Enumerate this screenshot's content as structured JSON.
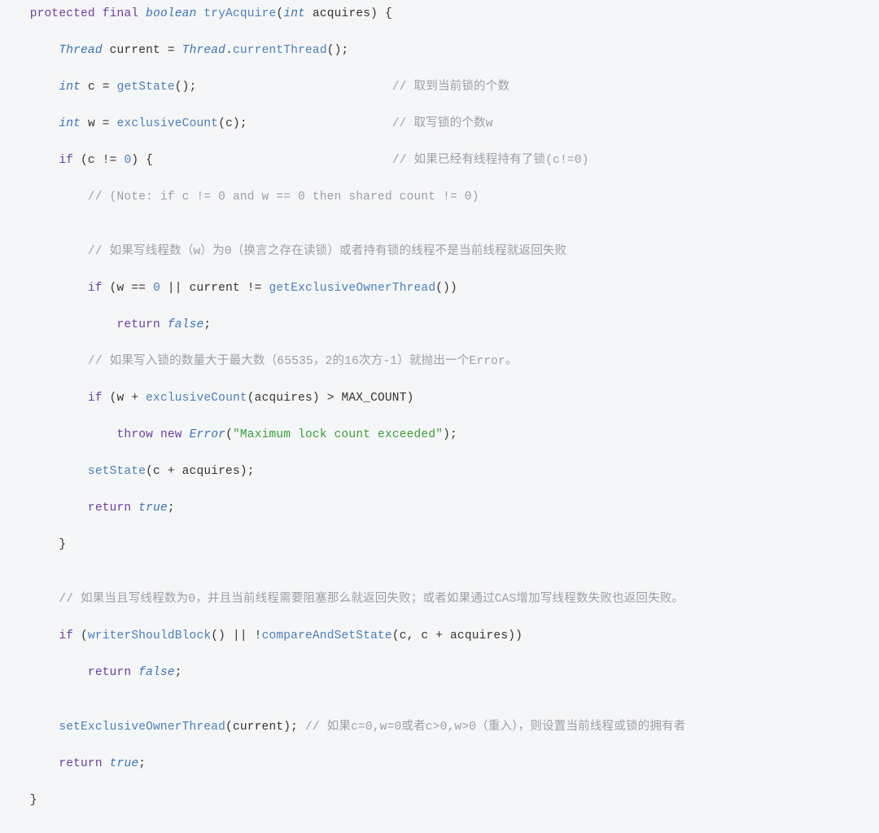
{
  "code": {
    "l1": {
      "kw_protected": "protected",
      "kw_final": "final",
      "type_boolean": "boolean",
      "fn": "tryAcquire",
      "type_int": "int",
      "param": "acquires",
      "brace": "{"
    },
    "l2": {
      "type": "Thread",
      "var": "current",
      "eq": "=",
      "cls": "Thread",
      "dot": ".",
      "fn": "currentThread",
      "tail": "();"
    },
    "l3": {
      "type": "int",
      "var": "c",
      "eq": "=",
      "fn": "getState",
      "tail": "();",
      "cmt": "// 取到当前锁的个数"
    },
    "l4": {
      "type": "int",
      "var": "w",
      "eq": "=",
      "fn": "exclusiveCount",
      "arg": "(c);",
      "cmt": "// 取写锁的个数w"
    },
    "l5": {
      "kw_if": "if",
      "cond": "(c != ",
      "zero": "0",
      "cond2": ") {",
      "cmt": "// 如果已经有线程持有了锁(c!=0)"
    },
    "l6": {
      "cmt": "// (Note: if c != 0 and w == 0 then shared count != 0)"
    },
    "l7": {
      "cmt": "// 如果写线程数（w）为0（换言之存在读锁）或者持有锁的线程不是当前线程就返回失败"
    },
    "l8": {
      "kw_if": "if",
      "open": "(w == ",
      "zero": "0",
      "mid": " || current != ",
      "fn": "getExclusiveOwnerThread",
      "close": "())"
    },
    "l9": {
      "kw_return": "return",
      "val": "false",
      "semi": ";"
    },
    "l10": {
      "cmt": "// 如果写入锁的数量大于最大数（65535，2的16次方-1）就抛出一个Error。"
    },
    "l11": {
      "kw_if": "if",
      "open": "(w + ",
      "fn": "exclusiveCount",
      "args": "(acquires) > MAX_COUNT)"
    },
    "l12": {
      "kw_throw": "throw",
      "kw_new": "new",
      "type": "Error",
      "open": "(",
      "str": "\"Maximum lock count exceeded\"",
      "close": ");"
    },
    "l13": {
      "fn": "setState",
      "args": "(c + acquires);"
    },
    "l14": {
      "kw_return": "return",
      "val": "true",
      "semi": ";"
    },
    "l15": {
      "brace": "}"
    },
    "l16": {
      "cmt": "// 如果当且写线程数为0，并且当前线程需要阻塞那么就返回失败；或者如果通过CAS增加写线程数失败也返回失败。"
    },
    "l17": {
      "kw_if": "if",
      "open": "(",
      "fn1": "writerShouldBlock",
      "mid": "() || !",
      "fn2": "compareAndSetState",
      "args": "(c, c + acquires))"
    },
    "l18": {
      "kw_return": "return",
      "val": "false",
      "semi": ";"
    },
    "l19": {
      "fn": "setExclusiveOwnerThread",
      "args": "(current);",
      "cmt": "// 如果c=0,w=0或者c>0,w>0（重入），则设置当前线程或锁的拥有者"
    },
    "l20": {
      "kw_return": "return",
      "val": "true",
      "semi": ";"
    },
    "l21": {
      "brace": "}"
    }
  }
}
